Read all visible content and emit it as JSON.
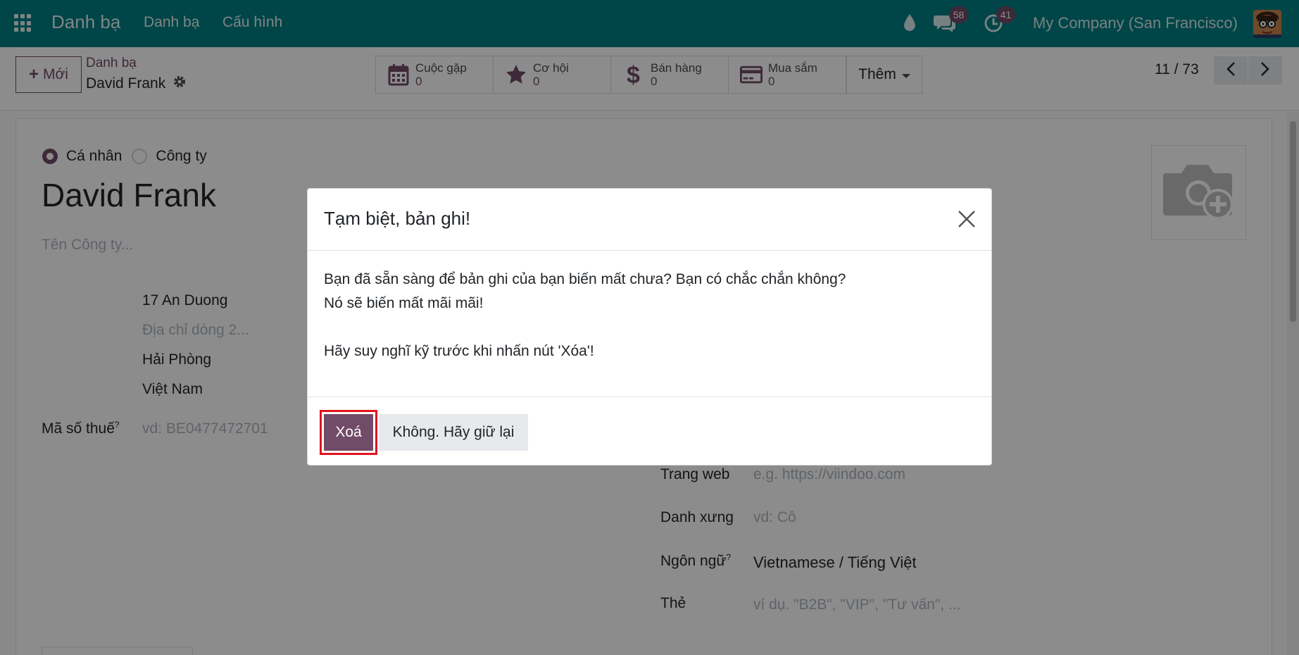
{
  "navbar": {
    "brand": "Danh bạ",
    "menu": [
      "Danh bạ",
      "Cấu hình"
    ],
    "messages_count": "58",
    "activities_count": "41",
    "company": "My Company (San Francisco)"
  },
  "control": {
    "new_label": "Mới",
    "breadcrumb": "Danh bạ",
    "record_name": "David Frank",
    "smart_buttons": [
      {
        "label": "Cuộc gặp",
        "count": "0",
        "icon": "calendar-icon"
      },
      {
        "label": "Cơ hội",
        "count": "0",
        "icon": "star-icon"
      },
      {
        "label": "Bán hàng",
        "count": "0",
        "icon": "dollar-icon"
      },
      {
        "label": "Mua sắm",
        "count": "0",
        "icon": "credit-card-icon"
      }
    ],
    "more_label": "Thêm",
    "pager": "11 / 73"
  },
  "form": {
    "type_individual": "Cá nhân",
    "type_company": "Công ty",
    "name": "David Frank",
    "company_placeholder": "Tên Công ty...",
    "street": "17 An Duong",
    "street2_placeholder": "Địa chỉ dòng 2...",
    "city": "Hải Phòng",
    "country": "Việt Nam",
    "vat_label": "Mã số thuế",
    "vat_placeholder": "vd: BE0477472701",
    "website_label": "Trang web",
    "website_placeholder": "e.g. https://viindoo.com",
    "title_label": "Danh xưng",
    "title_placeholder": "vd: Cô",
    "language_label": "Ngôn ngữ",
    "language_value": "Vietnamese / Tiếng Việt",
    "tags_label": "Thẻ",
    "tags_placeholder": "ví dụ. \"B2B\", \"VIP\", \"Tư vấn\", ..."
  },
  "modal": {
    "title": "Tạm biệt, bản ghi!",
    "line1": "Bạn đã sẵn sàng để bản ghi của bạn biến mất chưa? Bạn có chắc chắn không?",
    "line2": "Nó sẽ biến mất mãi mãi!",
    "line3": "Hãy suy nghĩ kỹ trước khi nhấn nút 'Xóa'!",
    "delete_label": "Xoá",
    "keep_label": "Không. Hãy giữ lại"
  },
  "colors": {
    "navbar": "#017e84",
    "primary": "#714b67",
    "highlight": "#e0141e"
  }
}
